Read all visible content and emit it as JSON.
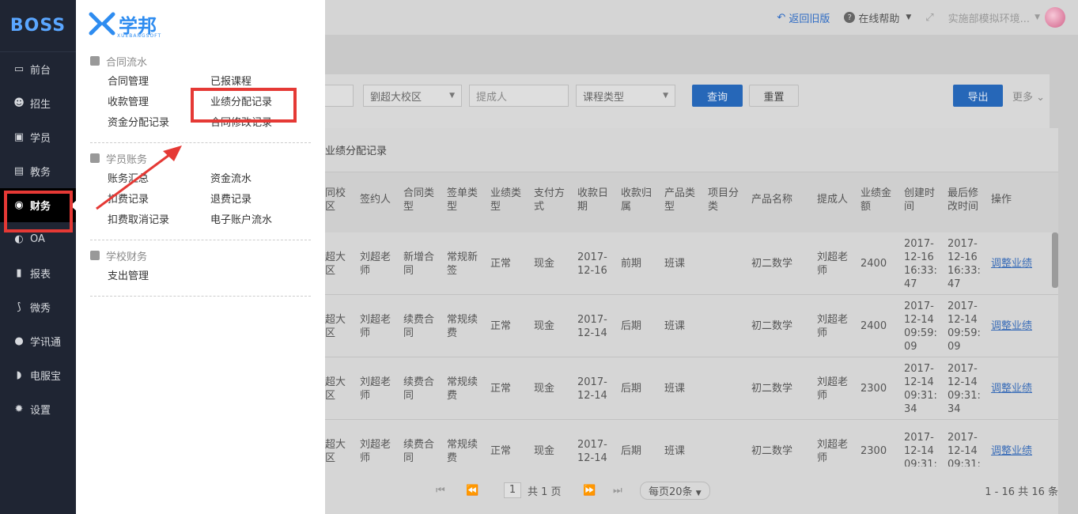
{
  "sidebar": {
    "logo": "BOSS",
    "items": [
      {
        "label": "前台",
        "icon": "calendar-icon"
      },
      {
        "label": "招生",
        "icon": "user-add-icon"
      },
      {
        "label": "学员",
        "icon": "id-card-icon"
      },
      {
        "label": "教务",
        "icon": "book-icon"
      },
      {
        "label": "财务",
        "icon": "money-icon"
      },
      {
        "label": "OA",
        "icon": "toggle-icon"
      },
      {
        "label": "报表",
        "icon": "bar-chart-icon"
      },
      {
        "label": "微秀",
        "icon": "wei-icon"
      },
      {
        "label": "学讯通",
        "icon": "location-icon"
      },
      {
        "label": "电服宝",
        "icon": "phone-icon"
      },
      {
        "label": "设置",
        "icon": "gear-icon"
      }
    ]
  },
  "flyout": {
    "brand": "学邦",
    "brand_sub": "XUEBANGSOFT",
    "sections": [
      {
        "title": "合同流水",
        "links": [
          "合同管理",
          "已报课程",
          "收款管理",
          "业绩分配记录",
          "资金分配记录",
          "合同修改记录"
        ]
      },
      {
        "title": "学员账务",
        "links": [
          "账务汇总",
          "资金流水",
          "扣费记录",
          "退费记录",
          "扣费取消记录",
          "电子账户流水"
        ]
      },
      {
        "title": "学校财务",
        "links": [
          "支出管理"
        ]
      }
    ]
  },
  "topbar": {
    "back": "返回旧版",
    "help": "在线帮助",
    "env": "实施部模拟环境..."
  },
  "filter": {
    "campus": "劉超大校区",
    "submitter_placeholder": "提成人",
    "course_type": "课程类型",
    "query": "查询",
    "reset": "重置",
    "export": "导出",
    "more": "更多"
  },
  "table": {
    "title": "业绩分配记录",
    "headers": [
      "同校\n区",
      "签约人",
      "合同类\n型",
      "签单类\n型",
      "业绩类\n型",
      "支付方\n式",
      "收款日\n期",
      "收款归\n属",
      "产品类\n型",
      "项目分\n类",
      "产品名称",
      "提成人",
      "业绩金\n额",
      "创建时\n间",
      "最后修\n改时间",
      "操作"
    ],
    "rows": [
      {
        "campus": "超大\n区",
        "signer": "刘超老\n师",
        "contract_type": "新增合\n同",
        "sign_type": "常规新\n签",
        "perf_type": "正常",
        "pay": "现金",
        "date": "2017-\n12-16",
        "belong": "前期",
        "prod_type": "班课",
        "proj": "",
        "product": "初二数学",
        "person": "刘超老\n师",
        "amount": "2400",
        "created": "2017-\n12-16\n16:33:\n47",
        "modified": "2017-\n12-16\n16:33:\n47",
        "action": "调整业绩"
      },
      {
        "campus": "超大\n区",
        "signer": "刘超老\n师",
        "contract_type": "续费合\n同",
        "sign_type": "常规续\n费",
        "perf_type": "正常",
        "pay": "现金",
        "date": "2017-\n12-14",
        "belong": "后期",
        "prod_type": "班课",
        "proj": "",
        "product": "初二数学",
        "person": "刘超老\n师",
        "amount": "2400",
        "created": "2017-\n12-14\n09:59:\n09",
        "modified": "2017-\n12-14\n09:59:\n09",
        "action": "调整业绩"
      },
      {
        "campus": "超大\n区",
        "signer": "刘超老\n师",
        "contract_type": "续费合\n同",
        "sign_type": "常规续\n费",
        "perf_type": "正常",
        "pay": "现金",
        "date": "2017-\n12-14",
        "belong": "后期",
        "prod_type": "班课",
        "proj": "",
        "product": "初二数学",
        "person": "刘超老\n师",
        "amount": "2300",
        "created": "2017-\n12-14\n09:31:\n34",
        "modified": "2017-\n12-14\n09:31:\n34",
        "action": "调整业绩"
      },
      {
        "campus": "超大\n区",
        "signer": "刘超老\n师",
        "contract_type": "续费合\n同",
        "sign_type": "常规续\n费",
        "perf_type": "正常",
        "pay": "现金",
        "date": "2017-\n12-14",
        "belong": "后期",
        "prod_type": "班课",
        "proj": "",
        "product": "初二数学",
        "person": "刘超老\n师",
        "amount": "2300",
        "created": "2017-\n12-14\n09:31:",
        "modified": "2017-\n12-14\n09:31:",
        "action": "调整业绩"
      }
    ]
  },
  "pager": {
    "page": "1",
    "total_pages": "共 1 页",
    "page_size": "每页20条",
    "summary": "1 - 16  共 16 条"
  },
  "annotation_color": "#e53935"
}
